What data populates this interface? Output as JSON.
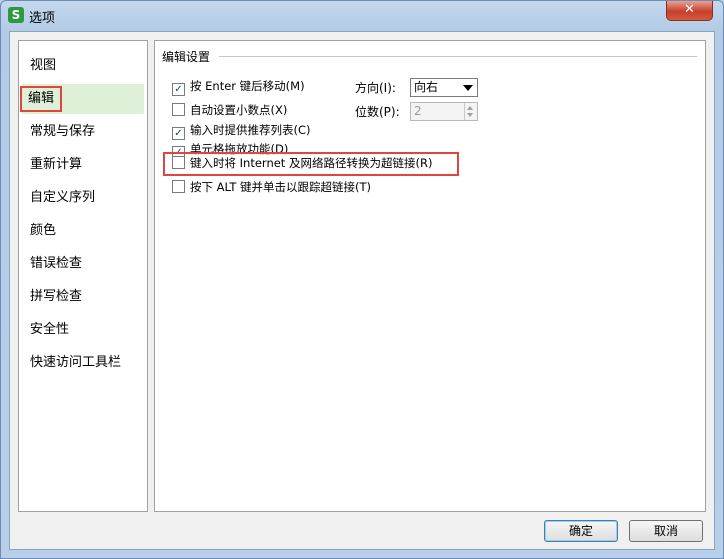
{
  "window": {
    "title": "选项",
    "app_icon_letter": "S",
    "close_glyph": "✕"
  },
  "sidebar": {
    "items": [
      {
        "label": "视图",
        "selected": false
      },
      {
        "label": "编辑",
        "selected": true
      },
      {
        "label": "常规与保存",
        "selected": false
      },
      {
        "label": "重新计算",
        "selected": false
      },
      {
        "label": "自定义序列",
        "selected": false
      },
      {
        "label": "颜色",
        "selected": false
      },
      {
        "label": "错误检查",
        "selected": false
      },
      {
        "label": "拼写检查",
        "selected": false
      },
      {
        "label": "安全性",
        "selected": false
      },
      {
        "label": "快速访问工具栏",
        "selected": false
      }
    ]
  },
  "panel": {
    "group_title": "编辑设置",
    "options": [
      {
        "label": "按 Enter 键后移动(M)",
        "checked": true
      },
      {
        "label": "自动设置小数点(X)",
        "checked": false
      },
      {
        "label": "输入时提供推荐列表(C)",
        "checked": true
      },
      {
        "label": "单元格拖放功能(D)",
        "checked": true
      },
      {
        "label": "键入时将 Internet 及网络路径转换为超链接(R)",
        "checked": false
      },
      {
        "label": "按下 ALT 键并单击以跟踪超链接(T)",
        "checked": false
      }
    ],
    "direction": {
      "label": "方向(I):",
      "value": "向右"
    },
    "digits": {
      "label": "位数(P):",
      "value": "2"
    }
  },
  "buttons": {
    "ok": "确定",
    "cancel": "取消"
  },
  "colors": {
    "highlight": "#e0463c",
    "selected_bg": "#dff0d8"
  }
}
